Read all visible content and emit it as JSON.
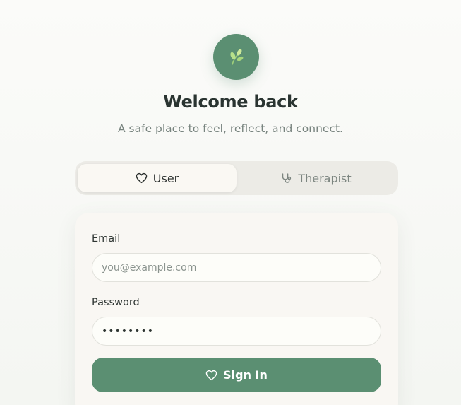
{
  "header": {
    "title": "Welcome back",
    "subtitle": "A safe place to feel, reflect, and connect.",
    "logo_icon": "leaf-sprout-icon"
  },
  "role_toggle": {
    "selected": "User",
    "options": [
      {
        "label": "User",
        "icon": "heart-icon",
        "active": true
      },
      {
        "label": "Therapist",
        "icon": "stethoscope-icon",
        "active": false
      }
    ]
  },
  "form": {
    "email_label": "Email",
    "email_placeholder": "you@example.com",
    "email_value": "",
    "password_label": "Password",
    "password_value": "••••••••",
    "signin_label": "Sign In",
    "signin_icon": "heart-icon"
  },
  "colors": {
    "accent": "#5b8f72",
    "title_text": "#2a3431",
    "muted_text": "#77837e",
    "card_bg": "#f9f7f3",
    "toggle_bg": "#ecebe6"
  }
}
